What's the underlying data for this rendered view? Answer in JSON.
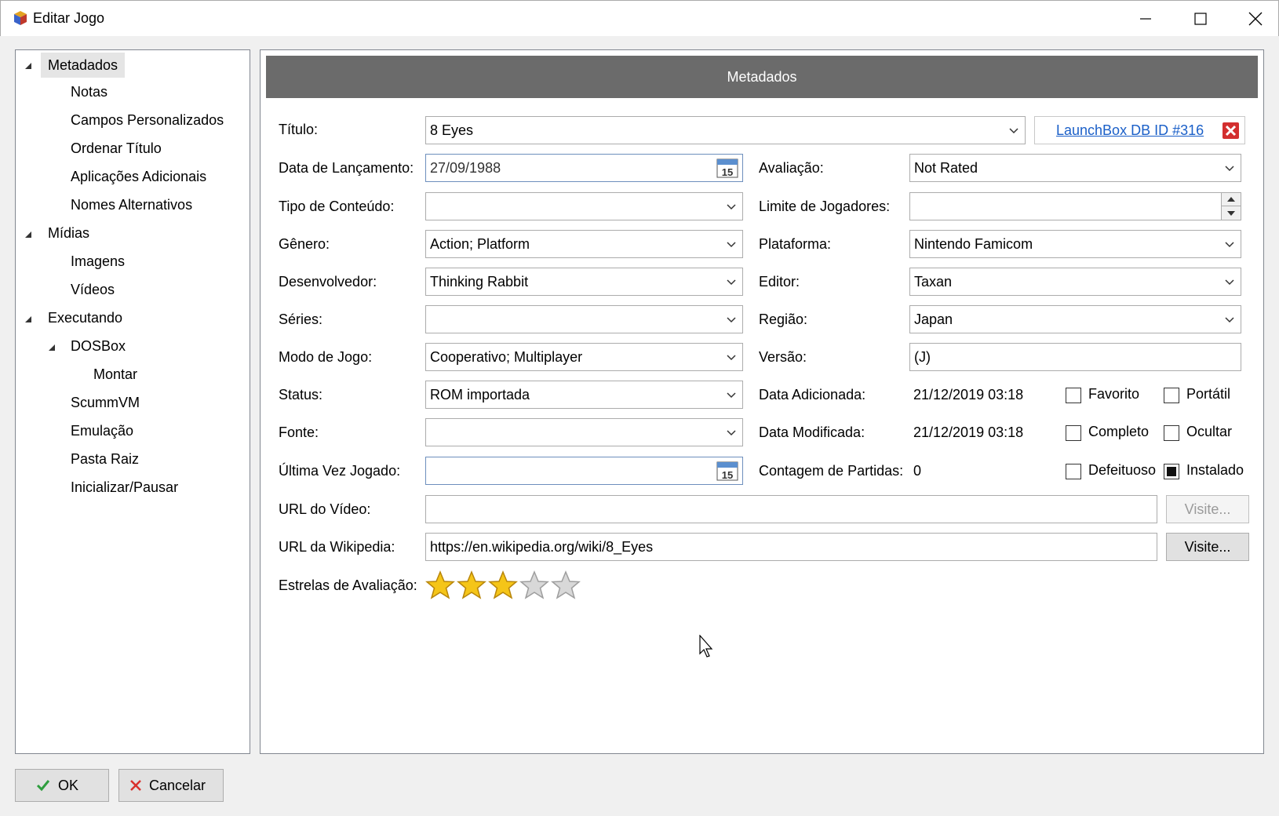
{
  "window": {
    "title": "Editar Jogo"
  },
  "tree": {
    "items": [
      {
        "label": "Metadados"
      },
      {
        "label": "Notas"
      },
      {
        "label": "Campos Personalizados"
      },
      {
        "label": "Ordenar Título"
      },
      {
        "label": "Aplicações Adicionais"
      },
      {
        "label": "Nomes Alternativos"
      },
      {
        "label": "Mídias"
      },
      {
        "label": "Imagens"
      },
      {
        "label": "Vídeos"
      },
      {
        "label": "Executando"
      },
      {
        "label": "DOSBox"
      },
      {
        "label": "Montar"
      },
      {
        "label": "ScummVM"
      },
      {
        "label": "Emulação"
      },
      {
        "label": "Pasta Raiz"
      },
      {
        "label": "Inicializar/Pausar"
      }
    ]
  },
  "panel": {
    "header": "Metadados",
    "title": {
      "label": "Título:",
      "value": "8 Eyes",
      "db_link": "LaunchBox DB ID #316"
    },
    "release_date": {
      "label": "Data de Lançamento:",
      "value": "27/09/1988",
      "cal_day": "15"
    },
    "rating": {
      "label": "Avaliação:",
      "value": "Not Rated"
    },
    "content_type": {
      "label": "Tipo de Conteúdo:",
      "value": ""
    },
    "max_players": {
      "label": "Limite de Jogadores:",
      "value": ""
    },
    "genre": {
      "label": "Gênero:",
      "value": "Action; Platform"
    },
    "platform": {
      "label": "Plataforma:",
      "value": "Nintendo Famicom"
    },
    "developer": {
      "label": "Desenvolvedor:",
      "value": "Thinking Rabbit"
    },
    "publisher": {
      "label": "Editor:",
      "value": "Taxan"
    },
    "series": {
      "label": "Séries:",
      "value": ""
    },
    "region": {
      "label": "Região:",
      "value": "Japan"
    },
    "play_mode": {
      "label": "Modo de Jogo:",
      "value": "Cooperativo; Multiplayer"
    },
    "version": {
      "label": "Versão:",
      "value": "(J)"
    },
    "status": {
      "label": "Status:",
      "value": "ROM importada"
    },
    "date_added": {
      "label": "Data Adicionada:",
      "value": "21/12/2019 03:18"
    },
    "source": {
      "label": "Fonte:",
      "value": ""
    },
    "date_modified": {
      "label": "Data Modificada:",
      "value": "21/12/2019 03:18"
    },
    "last_played": {
      "label": "Última Vez Jogado:",
      "value": "",
      "cal_day": "15"
    },
    "play_count": {
      "label": "Contagem de Partidas:",
      "value": "0"
    },
    "checkboxes": {
      "favorite": {
        "label": "Favorito",
        "checked": false
      },
      "portable": {
        "label": "Portátil",
        "checked": false
      },
      "completed": {
        "label": "Completo",
        "checked": false
      },
      "hide": {
        "label": "Ocultar",
        "checked": false
      },
      "broken": {
        "label": "Defeituoso",
        "checked": false
      },
      "installed": {
        "label": "Instalado",
        "checked": true
      }
    },
    "video_url": {
      "label": "URL do Vídeo:",
      "value": "",
      "button": "Visite..."
    },
    "wiki_url": {
      "label": "URL da Wikipedia:",
      "value": "https://en.wikipedia.org/wiki/8_Eyes",
      "button": "Visite..."
    },
    "star_rating": {
      "label": "Estrelas de Avaliação:",
      "value": 3,
      "max": 5
    }
  },
  "footer": {
    "ok": "OK",
    "cancel": "Cancelar"
  },
  "colors": {
    "header_bg": "#6b6b6b",
    "link": "#1a5fc8",
    "star_on": "#f5c518",
    "star_off": "#d8d8d8",
    "close_red": "#d32f2f"
  }
}
